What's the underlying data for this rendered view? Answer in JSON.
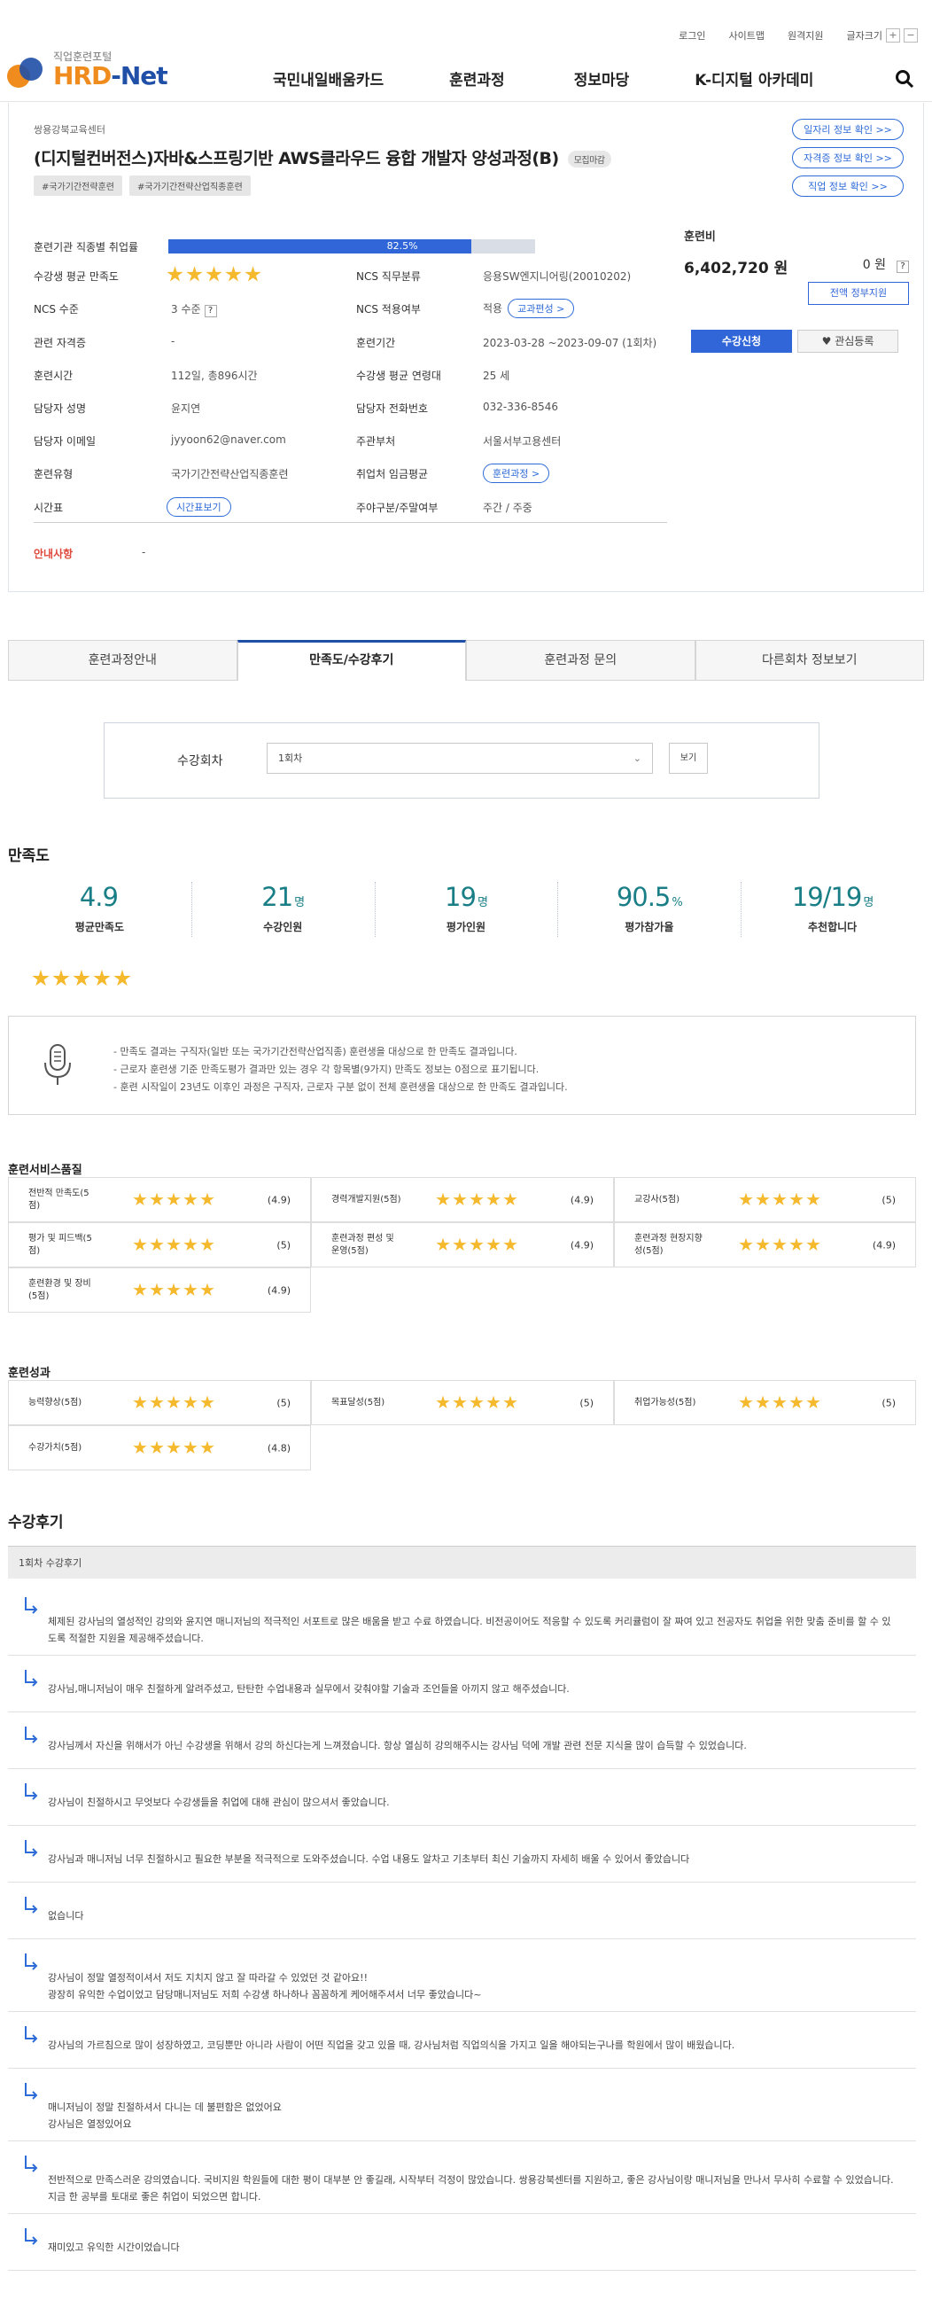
{
  "header": {
    "top_links": [
      "로그인",
      "사이트맵",
      "원격지원",
      "글자크기"
    ],
    "logo_sub": "직업훈련포털",
    "logo_main_a": "HRD",
    "logo_main_b": "-Net",
    "nav": [
      "국민내일배움카드",
      "훈련과정",
      "정보마당",
      "K-디지털 아카데미"
    ]
  },
  "course": {
    "org": "쌍용강북교육센터",
    "title": "(디지털컨버전스)자바&스프링기반 AWS클라우드 융합 개발자 양성과정(B)",
    "status_badge": "모집마감",
    "tags": [
      "#국가기간전략훈련",
      "#국가기간전략산업직종훈련"
    ],
    "side_links": [
      "일자리 정보 확인 >>",
      "자격증 정보 확인 >>",
      "직업 정보 확인 >>"
    ],
    "employment_label": "훈련기관 직종별 취업률",
    "employment_rate": 82.5,
    "employment_rate_text": "82.5%",
    "left_labels": [
      "수강생 평균 만족도",
      "NCS 수준",
      "관련 자격증",
      "훈련시간",
      "담당자 성명",
      "담당자 이메일",
      "훈련유형",
      "시간표"
    ],
    "left_values": [
      "",
      "3 수준",
      "-",
      "112일, 총896시간",
      "윤지연",
      "jyyoon62@naver.com",
      "국가기간전략산업직종훈련",
      ""
    ],
    "ncs_q": "?",
    "timetable_btn": "시간표보기",
    "right_labels": [
      "NCS 직무분류",
      "NCS 적용여부",
      "훈련기간",
      "수강생 평균 연령대",
      "담당자 전화번호",
      "주관부처",
      "취업처 임금평균",
      "주야구분/주말여부"
    ],
    "right_values": [
      "응용SW엔지니어링(20010202)",
      "적용",
      "2023-03-28 ~2023-09-07 (1회차)",
      "25 세",
      "032-336-8546",
      "서울서부고용센터",
      "",
      "주간 / 주중"
    ],
    "curriculum_btn": "교과편성 >",
    "course_btn": "훈련과정 >",
    "notice_label": "안내사항",
    "notice_value": "-",
    "fee_label": "훈련비",
    "fee_amount": "6,402,720 원",
    "self_pay": "0 원",
    "fee_q": "?",
    "full_support": "전액 정부지원",
    "apply_btn": "수강신청",
    "fav_btn": "관심등록"
  },
  "tabs": [
    "훈련과정안내",
    "만족도/수강후기",
    "훈련과정 문의",
    "다른회차 정보보기"
  ],
  "session": {
    "label": "수강회차",
    "selected": "1회차",
    "view_btn": "보기"
  },
  "satisfaction": {
    "title": "만족도",
    "stats": [
      {
        "value": "4.9",
        "unit": "",
        "label": "평균만족도"
      },
      {
        "value": "21",
        "unit": "명",
        "label": "수강인원"
      },
      {
        "value": "19",
        "unit": "명",
        "label": "평가인원"
      },
      {
        "value": "90.5",
        "unit": "%",
        "label": "평가참가율"
      },
      {
        "value": "19/19",
        "unit": "명",
        "label": "추천합니다"
      }
    ],
    "rating_stars": 5,
    "notes": [
      "- 만족도 결과는 구직자(일반 또는 국가기간전략산업직종) 훈련생을 대상으로 한 만족도 결과입니다.",
      "- 근로자 훈련생 기준 만족도평가 결과만 있는 경우 각 항목별(9가지) 만족도 정보는 0점으로 표기됩니다.",
      "- 훈련 시작일이 23년도 이후인 과정은 구직자, 근로자 구분 없이 전체 훈련생을 대상으로 한 만족도 결과입니다."
    ]
  },
  "service_quality": {
    "title": "훈련서비스품질",
    "items": [
      {
        "label": "전반적 만족도(5점)",
        "score": "(4.9)"
      },
      {
        "label": "경력개발지원(5점)",
        "score": "(4.9)"
      },
      {
        "label": "교강사(5점)",
        "score": "(5)"
      },
      {
        "label": "평가 및 피드백(5점)",
        "score": "(5)"
      },
      {
        "label": "훈련과정 편성 및 운영(5점)",
        "score": "(4.9)"
      },
      {
        "label": "훈련과정 현장지향성(5점)",
        "score": "(4.9)"
      },
      {
        "label": "훈련환경 및 장비(5점)",
        "score": "(4.9)"
      }
    ]
  },
  "outcomes": {
    "title": "훈련성과",
    "items": [
      {
        "label": "능력향상(5점)",
        "score": "(5)"
      },
      {
        "label": "목표달성(5점)",
        "score": "(5)"
      },
      {
        "label": "취업가능성(5점)",
        "score": "(5)"
      },
      {
        "label": "수강가치(5점)",
        "score": "(4.8)"
      }
    ]
  },
  "reviews": {
    "title": "수강후기",
    "session_head": "1회차 수강후기",
    "items": [
      [
        "체제된 강사님의 열성적인 강의와 윤지연 매니저님의 적극적인 서포트로 많은 배움을 받고 수료 하였습니다. 비전공이어도 적응할 수 있도록 커리큘럼이 잘 짜여 있고 전공자도 취업을 위한 맞춤 준비를 할 수 있도록 적절한 지원을 제공해주셨습니다."
      ],
      [
        "강사님,매니저님이 매우 친절하게 알려주셨고, 탄탄한 수업내용과 실무에서 갖춰야할 기술과 조언들을 아끼지 않고 해주셨습니다."
      ],
      [
        "강사님께서 자신을 위해서가 아닌 수강생을 위해서 강의 하신다는게 느껴졌습니다. 항상 열심히 강의해주시는 강사님 덕에 개발 관련 전문 지식을 많이 습득할 수 있었습니다."
      ],
      [
        "강사님이 친절하시고 무엇보다 수강생들을 취업에 대해 관심이 많으셔서 좋았습니다."
      ],
      [
        "강사님과 매니저님 너무 친절하시고 필요한 부분을 적극적으로 도와주셨습니다. 수업 내용도 알차고 기초부터 최신 기술까지 자세히 배울 수 있어서 좋았습니다"
      ],
      [
        "없습니다"
      ],
      [
        "강사님이 정말 열정적이셔서 저도 지치지 않고 잘 따라갈 수 있었던 것 같아요!!",
        "광장히 유익한 수업이었고 담당매니저님도 저희 수강생 하나하나 꼼꼼하게 케어해주셔서 너무 좋았습니다~"
      ],
      [
        "강사님의 가르침으로 많이 성장하였고, 코딩뿐만 아니라 사람이 어떤 직업을 갖고 있을 때, 강사님처럼 직업의식을 가지고 일을 해야되는구나를 학원에서 많이 배웠습니다."
      ],
      [
        "매니저님이 정말 친절하셔서 다니는 데 불편함은 없었어요",
        "강사님은 열정있어요"
      ],
      [
        "전반적으로 만족스러운 강의였습니다. 국비지원 학원들에 대한 평이 대부분 안 좋길래, 시작부터 걱정이 많았습니다. 쌍용강북센터를 지원하고, 좋은 강사님이랑 매니저님을 만나서 무사히 수료할 수 있었습니다. 지금 한 공부를 토대로 좋은 취업이 되었으면 합니다."
      ],
      [
        "재미있고 유익한 시간이었습니다"
      ]
    ]
  }
}
